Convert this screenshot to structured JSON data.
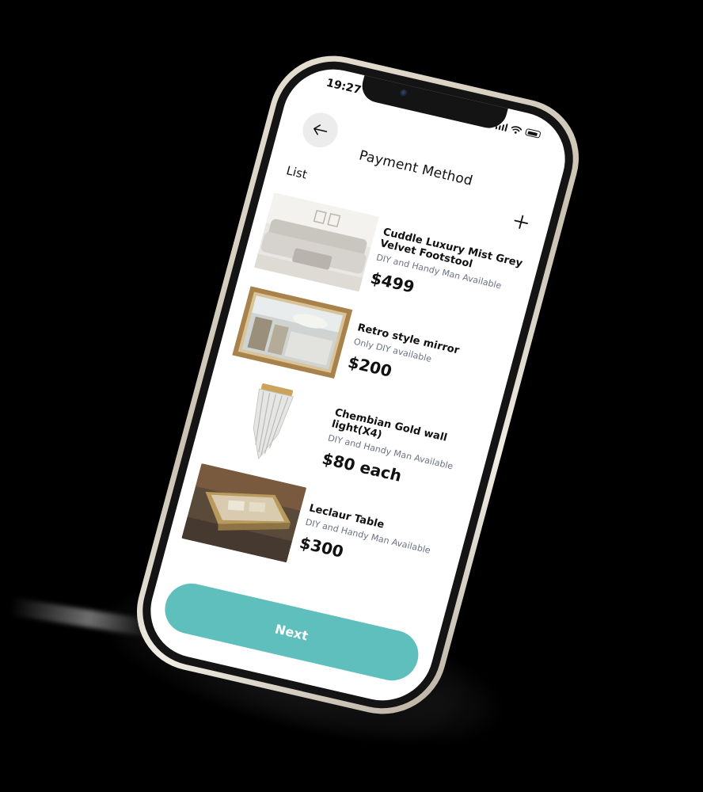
{
  "status_bar": {
    "time": "19:27"
  },
  "header": {
    "title": "Payment Method",
    "back_icon": "arrow-left-icon"
  },
  "list": {
    "label": "List",
    "add_icon": "plus-icon",
    "items": [
      {
        "name": "Cuddle Luxury Mist Grey Velvet Footstool",
        "availability": "DIY and Handy Man Available",
        "price": "$499",
        "image": "grey-sofa-image"
      },
      {
        "name": "Retro style mirror",
        "availability": "Only DIY available",
        "price": "$200",
        "image": "gold-mirror-image"
      },
      {
        "name": "Chembian Gold wall light(X4)",
        "availability": "DIY and Handy Man Available",
        "price": "$80 each",
        "image": "crystal-wall-light-image"
      },
      {
        "name": "Leclaur Table",
        "availability": "DIY and Handy Man Available",
        "price": "$300",
        "image": "glass-table-image"
      }
    ]
  },
  "footer": {
    "next_label": "Next"
  },
  "colors": {
    "accent": "#5ebfbc",
    "frame": "#d9d2c3",
    "muted_text": "#6b7280"
  }
}
